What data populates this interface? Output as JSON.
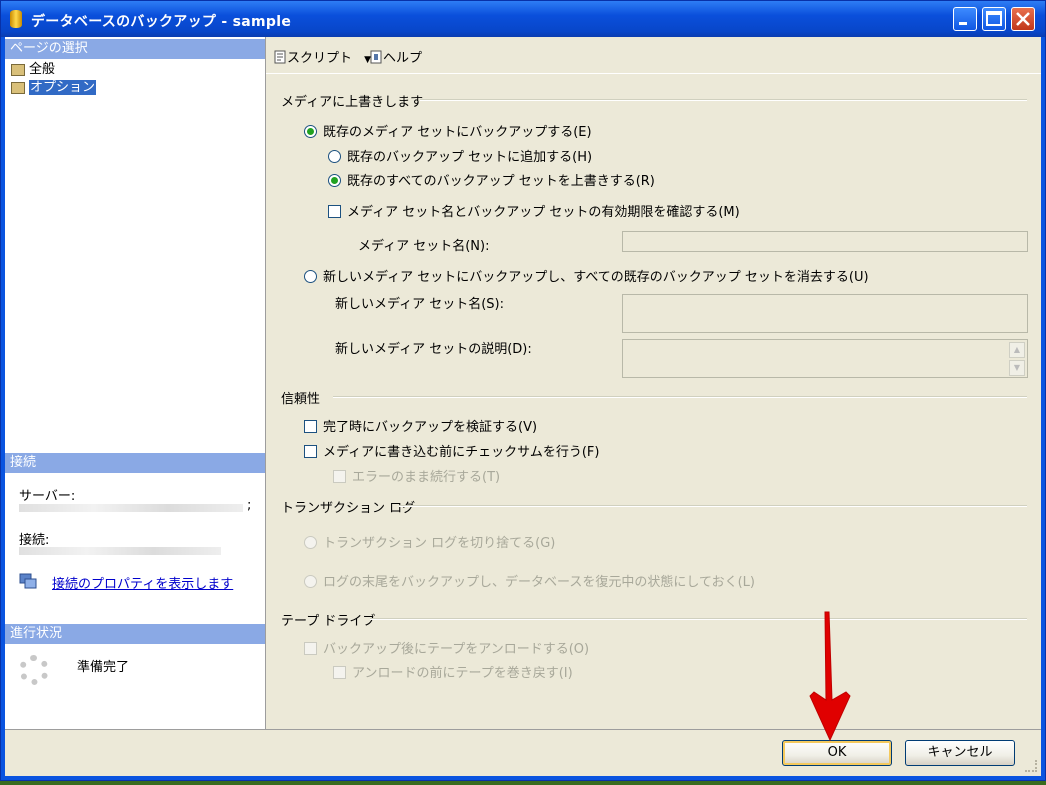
{
  "window": {
    "title": "データベースのバックアップ - sample"
  },
  "left": {
    "select_header": "ページの選択",
    "nav": [
      {
        "label": "全般"
      },
      {
        "label": "オプション"
      }
    ],
    "connection_header": "接続",
    "server_label": "サーバー:",
    "server_value_trail": ";",
    "connection_label": "接続:",
    "connection_props_link": "接続のプロパティを表示します",
    "progress_header": "進行状況",
    "progress_status": "準備完了"
  },
  "toolbar": {
    "script_label": "スクリプト",
    "help_label": "ヘルプ"
  },
  "overwrite": {
    "heading": "メディアに上書きします",
    "backup_existing": "既存のメディア セットにバックアップする(E)",
    "append": "既存のバックアップ セットに追加する(H)",
    "overwrite_all": "既存のすべてのバックアップ セットを上書きする(R)",
    "check_name": "メディア セット名とバックアップ セットの有効期限を確認する(M)",
    "media_set_name_label": "メディア セット名(N):",
    "new_media_set": "新しいメディア セットにバックアップし、すべての既存のバックアップ セットを消去する(U)",
    "new_media_name_label": "新しいメディア セット名(S):",
    "new_media_desc_label": "新しいメディア セットの説明(D):"
  },
  "reliability": {
    "heading": "信頼性",
    "verify": "完了時にバックアップを検証する(V)",
    "checksum": "メディアに書き込む前にチェックサムを行う(F)",
    "continue_on_error": "エラーのまま続行する(T)"
  },
  "txlog": {
    "heading": "トランザクション ログ",
    "truncate": "トランザクション ログを切り捨てる(G)",
    "tail": "ログの末尾をバックアップし、データベースを復元中の状態にしておく(L)"
  },
  "tape": {
    "heading": "テープ ドライブ",
    "unload": "バックアップ後にテープをアンロードする(O)",
    "rewind": "アンロードの前にテープを巻き戻す(I)"
  },
  "buttons": {
    "ok": "OK",
    "cancel": "キャンセル"
  },
  "colors": {
    "title_blue": "#0a4fdb",
    "panel_bg": "#ece9d8",
    "section_header": "#8aa9e5",
    "radio_dot": "#21a121",
    "annotation_arrow": "#e00000"
  }
}
